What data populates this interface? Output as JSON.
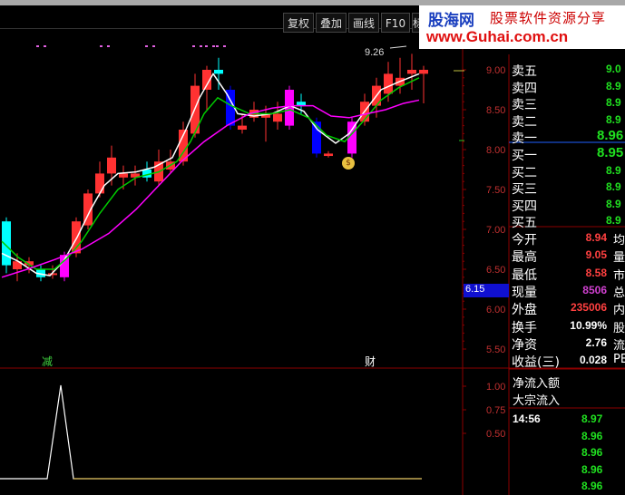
{
  "toolbar": {
    "buttons": [
      "复权",
      "叠加",
      "画线",
      "F10",
      "标"
    ]
  },
  "watermark": {
    "site_cn": "股海网",
    "slogan": "股票软件资源分享",
    "url": "www.Guhai.com.cn"
  },
  "main_chart": {
    "peak_label": "9.26",
    "current_price_tag": "6.15",
    "marker_left": "减",
    "marker_right": "财",
    "y_ticks": [
      "9.00",
      "8.50",
      "8.00",
      "7.50",
      "7.00",
      "6.50",
      "6.00",
      "5.50"
    ]
  },
  "indicator_chart": {
    "y_ticks": [
      "1.00",
      "0.75",
      "0.50"
    ]
  },
  "order_book": {
    "sell": [
      {
        "label": "卖五",
        "price": "9.0"
      },
      {
        "label": "卖四",
        "price": "8.9"
      },
      {
        "label": "卖三",
        "price": "8.9"
      },
      {
        "label": "卖二",
        "price": "8.9"
      },
      {
        "label": "卖一",
        "price": "8.96"
      }
    ],
    "buy": [
      {
        "label": "买一",
        "price": "8.95"
      },
      {
        "label": "买二",
        "price": "8.9"
      },
      {
        "label": "买三",
        "price": "8.9"
      },
      {
        "label": "买四",
        "price": "8.9"
      },
      {
        "label": "买五",
        "price": "8.9"
      }
    ]
  },
  "stats": [
    {
      "label": "今开",
      "value": "8.94",
      "right": "均",
      "color": "#ff4040"
    },
    {
      "label": "最高",
      "value": "9.05",
      "right": "量",
      "color": "#ff4040"
    },
    {
      "label": "最低",
      "value": "8.58",
      "right": "市",
      "color": "#ff4040"
    },
    {
      "label": "现量",
      "value": "8506",
      "right": "总",
      "color": "#d040d0"
    },
    {
      "label": "外盘",
      "value": "235006",
      "right": "内",
      "color": "#ff4040"
    },
    {
      "label": "换手",
      "value": "10.99%",
      "right": "股",
      "color": "#ffffff"
    },
    {
      "label": "净资",
      "value": "2.76",
      "right": "流",
      "color": "#ffffff"
    },
    {
      "label": "收益(三)",
      "value": "0.028",
      "right": "PE",
      "color": "#ffffff"
    }
  ],
  "flow": {
    "net_inflow": "净流入额",
    "block_inflow": "大宗流入"
  },
  "ticks": {
    "time": "14:56",
    "prices": [
      "8.97",
      "8.96",
      "8.96",
      "8.96",
      "8.96"
    ]
  },
  "colors": {
    "up": "#ff3232",
    "down_candle": "#0000ff",
    "cyan": "#00ffff",
    "ma_white": "#ffffff",
    "ma_green": "#00cc00",
    "ma_purple": "#ff00ff",
    "grid_red": "#8b0000"
  }
}
